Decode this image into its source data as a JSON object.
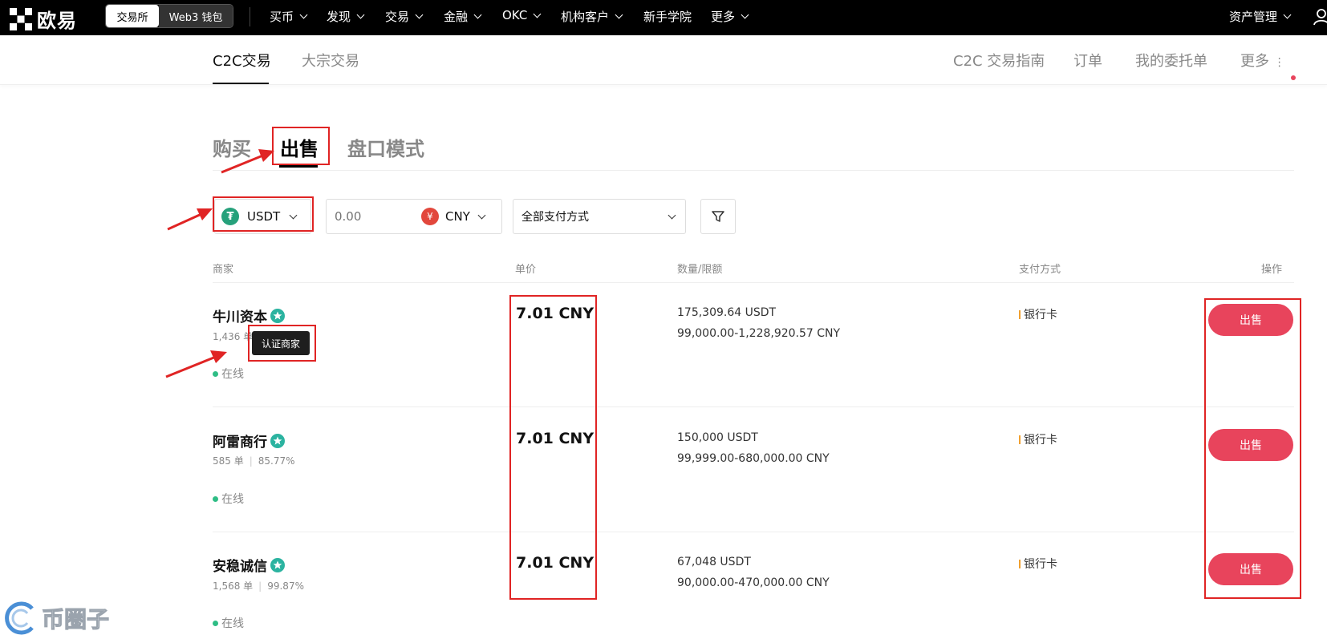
{
  "topnav": {
    "logo": "欧易",
    "switch": {
      "active": "交易所",
      "inactive": "Web3 钱包"
    },
    "items": [
      "买币",
      "发现",
      "交易",
      "金融",
      "OKC",
      "机构客户",
      "新手学院",
      "更多"
    ],
    "asset_management": "资产管理"
  },
  "subnav": {
    "tabs": [
      "C2C交易",
      "大宗交易"
    ],
    "right": [
      "C2C 交易指南",
      "订单",
      "我的委托单",
      "更多"
    ]
  },
  "trade_tabs": [
    "购买",
    "出售",
    "盘口模式"
  ],
  "filters": {
    "coin": "USDT",
    "amount_placeholder": "0.00",
    "currency": "CNY",
    "currency_symbol": "¥",
    "payment": "全部支付方式"
  },
  "table": {
    "headers": [
      "商家",
      "单价",
      "数量/限额",
      "支付方式",
      "操作"
    ],
    "rows": [
      {
        "name": "牛川资本",
        "orders": "1,436 单",
        "rate": "",
        "status": "在线",
        "price": "7.01 CNY",
        "qty": "175,309.64 USDT",
        "limit": "99,000.00-1,228,920.57 CNY",
        "payment": "银行卡",
        "action": "出售"
      },
      {
        "name": "阿雷商行",
        "orders": "585 单",
        "rate": "85.77%",
        "status": "在线",
        "price": "7.01 CNY",
        "qty": "150,000 USDT",
        "limit": "99,999.00-680,000.00 CNY",
        "payment": "银行卡",
        "action": "出售"
      },
      {
        "name": "安稳诚信",
        "orders": "1,568 单",
        "rate": "99.87%",
        "status": "在线",
        "price": "7.01 CNY",
        "qty": "67,048 USDT",
        "limit": "90,000.00-470,000.00 CNY",
        "payment": "银行卡",
        "action": "出售"
      }
    ]
  },
  "tooltip": "认证商家",
  "watermark": "币圈子",
  "colors": {
    "accent": "#e8445c",
    "annotation": "#e02424",
    "online": "#2ebd85",
    "usdt": "#26a17b"
  }
}
